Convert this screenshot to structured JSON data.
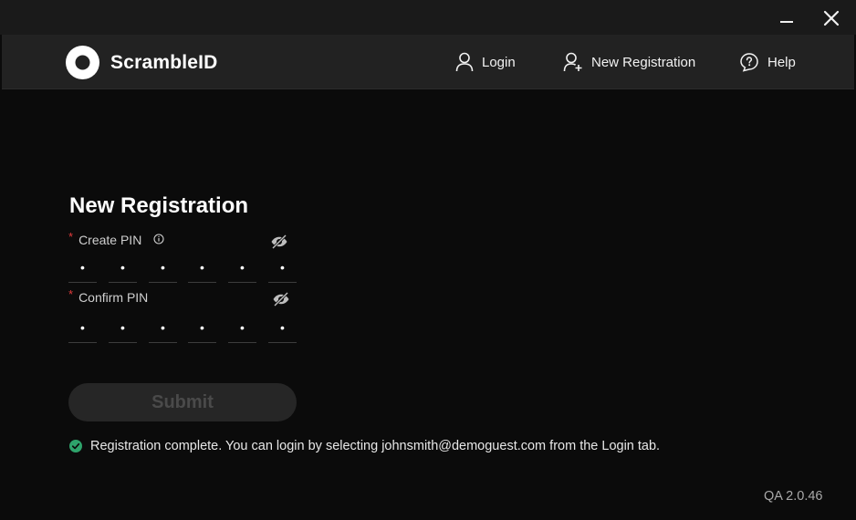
{
  "window": {
    "minimize_icon": "minimize-icon",
    "close_icon": "close-icon"
  },
  "header": {
    "brand": "ScrambleID",
    "nav": {
      "login": "Login",
      "new_registration": "New Registration",
      "help": "Help"
    }
  },
  "form": {
    "title": "New Registration",
    "create_pin": {
      "required_mark": "*",
      "label": "Create PIN",
      "digits": [
        "•",
        "•",
        "•",
        "•",
        "•",
        "•"
      ]
    },
    "confirm_pin": {
      "required_mark": "*",
      "label": "Confirm PIN",
      "digits": [
        "•",
        "•",
        "•",
        "•",
        "•",
        "•"
      ]
    },
    "submit_label": "Submit"
  },
  "status": {
    "message": "Registration complete. You can login by selecting johnsmith@demoguest.com from the Login tab."
  },
  "footer": {
    "version": "QA 2.0.46"
  },
  "colors": {
    "background": "#0b0b0b",
    "header": "#222222",
    "titlebar": "#1a1a1a",
    "required": "#e23b3b",
    "success": "#2ea36b",
    "submit_disabled_bg": "#262626",
    "submit_disabled_text": "#4a4a4a"
  }
}
